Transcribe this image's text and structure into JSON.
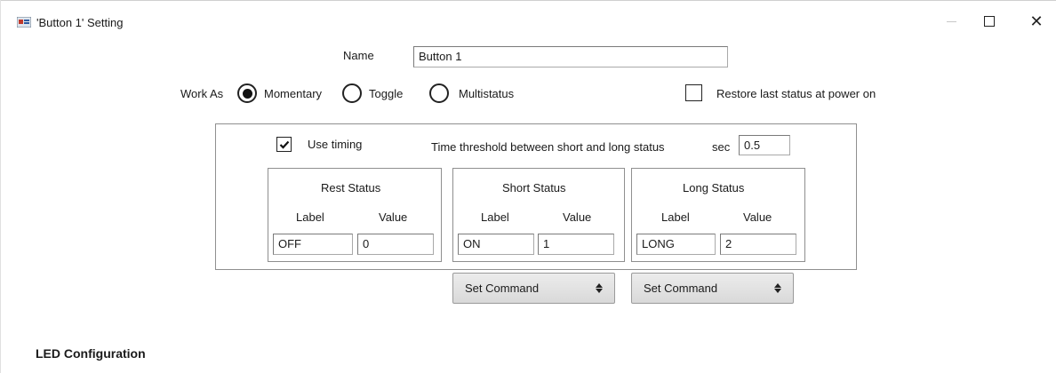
{
  "window": {
    "title": "'Button 1' Setting",
    "app_icon": "app-logo-icon",
    "controls": {
      "minimize": "minimize-icon",
      "maximize": "maximize-icon",
      "close": "close-icon"
    }
  },
  "name": {
    "label": "Name",
    "value": "Button 1"
  },
  "work_as": {
    "label": "Work As",
    "options": [
      {
        "label": "Momentary",
        "selected": true
      },
      {
        "label": "Toggle",
        "selected": false
      },
      {
        "label": "Multistatus",
        "selected": false
      }
    ]
  },
  "restore": {
    "label": "Restore last status at power on",
    "checked": false
  },
  "timing": {
    "use_label": "Use timing",
    "use_checked": true,
    "threshold_label": "Time threshold between short and long status",
    "unit": "sec",
    "value": "0.5"
  },
  "statuses": [
    {
      "title": "Rest Status",
      "label_header": "Label",
      "value_header": "Value",
      "label": "OFF",
      "value": "0"
    },
    {
      "title": "Short Status",
      "label_header": "Label",
      "value_header": "Value",
      "label": "ON",
      "value": "1"
    },
    {
      "title": "Long Status",
      "label_header": "Label",
      "value_header": "Value",
      "label": "LONG",
      "value": "2"
    }
  ],
  "commands": [
    {
      "label": "Set Command"
    },
    {
      "label": "Set Command"
    }
  ],
  "led_section": {
    "title": "LED Configuration"
  }
}
